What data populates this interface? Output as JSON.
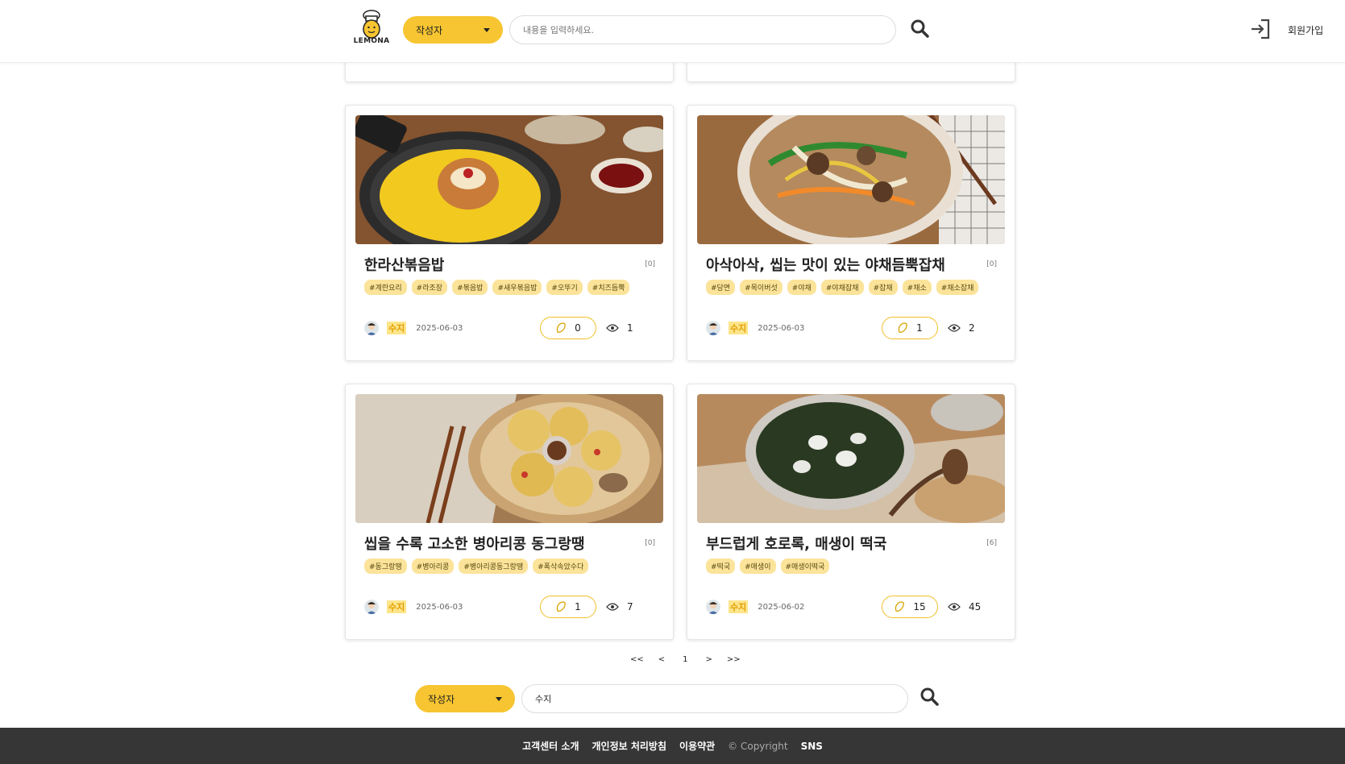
{
  "header": {
    "logo_text": "LEMONA",
    "search_type": "작성자",
    "search_placeholder": "내용을 입력하세요.",
    "signup_label": "회원가입"
  },
  "cards": [
    {
      "title": "한라산볶음밥",
      "count": "[0]",
      "tags": [
        "#계란요리",
        "#라조장",
        "#볶음밥",
        "#새우볶음밥",
        "#오뚜기",
        "#치즈듬뿍"
      ],
      "author": "수지",
      "date": "2025-06-03",
      "likes": "0",
      "views": "1"
    },
    {
      "title": "아삭아삭, 씹는 맛이 있는 야채듬뿍잡채",
      "count": "[0]",
      "tags": [
        "#당면",
        "#목이버섯",
        "#야채",
        "#야채잡채",
        "#잡채",
        "#채소",
        "#채소잡채"
      ],
      "author": "수지",
      "date": "2025-06-03",
      "likes": "1",
      "views": "2"
    },
    {
      "title": "씹을 수록 고소한 병아리콩 동그랑땡",
      "count": "[0]",
      "tags": [
        "#동그랑땡",
        "#병아리콩",
        "#병아리콩동그랑땡",
        "#폭삭속았수다"
      ],
      "author": "수지",
      "date": "2025-06-03",
      "likes": "1",
      "views": "7"
    },
    {
      "title": "부드럽게 호로록, 매생이 떡국",
      "count": "[6]",
      "tags": [
        "#떡국",
        "#매생이",
        "#매생이떡국"
      ],
      "author": "수지",
      "date": "2025-06-02",
      "likes": "15",
      "views": "45"
    }
  ],
  "pagination": {
    "first": "<<",
    "prev": "<",
    "current": "1",
    "next": ">",
    "last": ">>"
  },
  "bottom_search": {
    "search_type": "작성자",
    "value": "수지"
  },
  "footer": {
    "customer_center": "고객센터 소개",
    "privacy": "개인정보 처리방침",
    "terms": "이용약관",
    "copyright": "© Copyright",
    "sns": "SNS"
  },
  "colors": {
    "accent": "#f7c531",
    "tag_bg": "#fbe39a",
    "footer_bg": "#363636"
  }
}
